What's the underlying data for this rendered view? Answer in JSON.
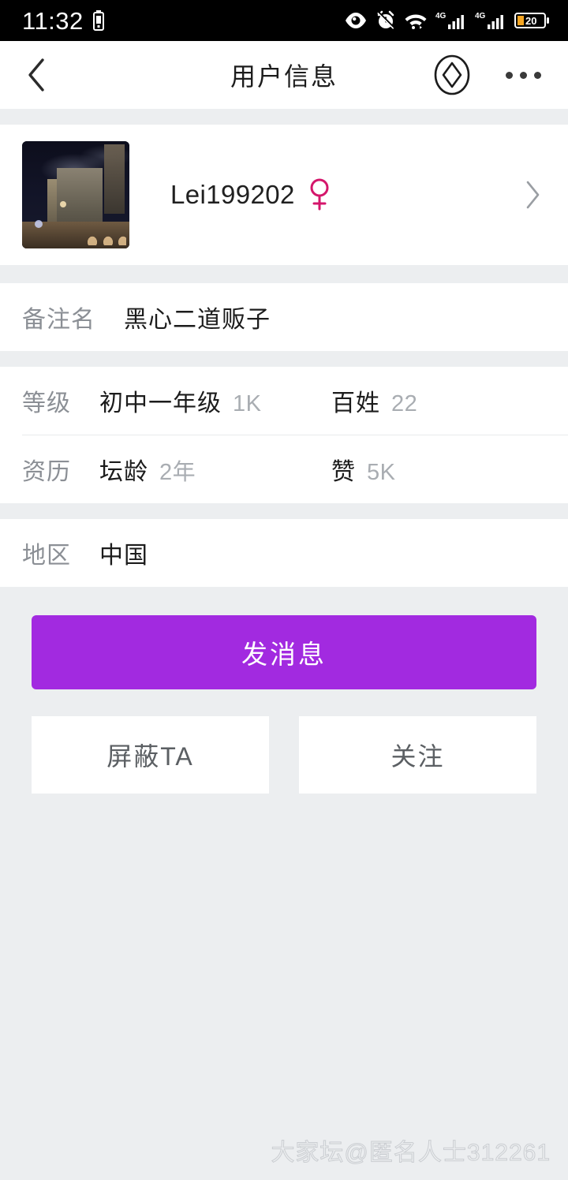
{
  "status_bar": {
    "time": "11:32",
    "icons": [
      "battery-small-icon",
      "eye-icon",
      "alarm-silent-icon",
      "wifi-icon",
      "signal-4g-icon",
      "signal-4g-icon-2",
      "battery-icon"
    ],
    "battery_level": "20"
  },
  "nav": {
    "back_icon": "chevron-left-icon",
    "title": "用户信息",
    "diamond_icon": "diamond-circle-icon",
    "more_icon": "more-dots-icon"
  },
  "profile": {
    "avatar_alt": "night-city-building-photo",
    "username": "Lei199202",
    "gender": "female",
    "gender_color": "#d4166b",
    "chevron": "chevron-right-icon"
  },
  "remark": {
    "label": "备注名",
    "value": "黑心二道贩子"
  },
  "stats": [
    {
      "label": "等级",
      "value": "初中一年级",
      "count": "1K",
      "right_label": "百姓",
      "right_count": "22"
    },
    {
      "label": "资历",
      "value": "坛龄",
      "count": "2年",
      "right_label": "赞",
      "right_count": "5K"
    }
  ],
  "region": {
    "label": "地区",
    "value": "中国"
  },
  "actions": {
    "primary_label": "发消息",
    "primary_color": "#a22ae0",
    "block_label": "屏蔽TA",
    "follow_label": "关注"
  },
  "watermark": {
    "text": "大家坛@匿名人士312261"
  }
}
